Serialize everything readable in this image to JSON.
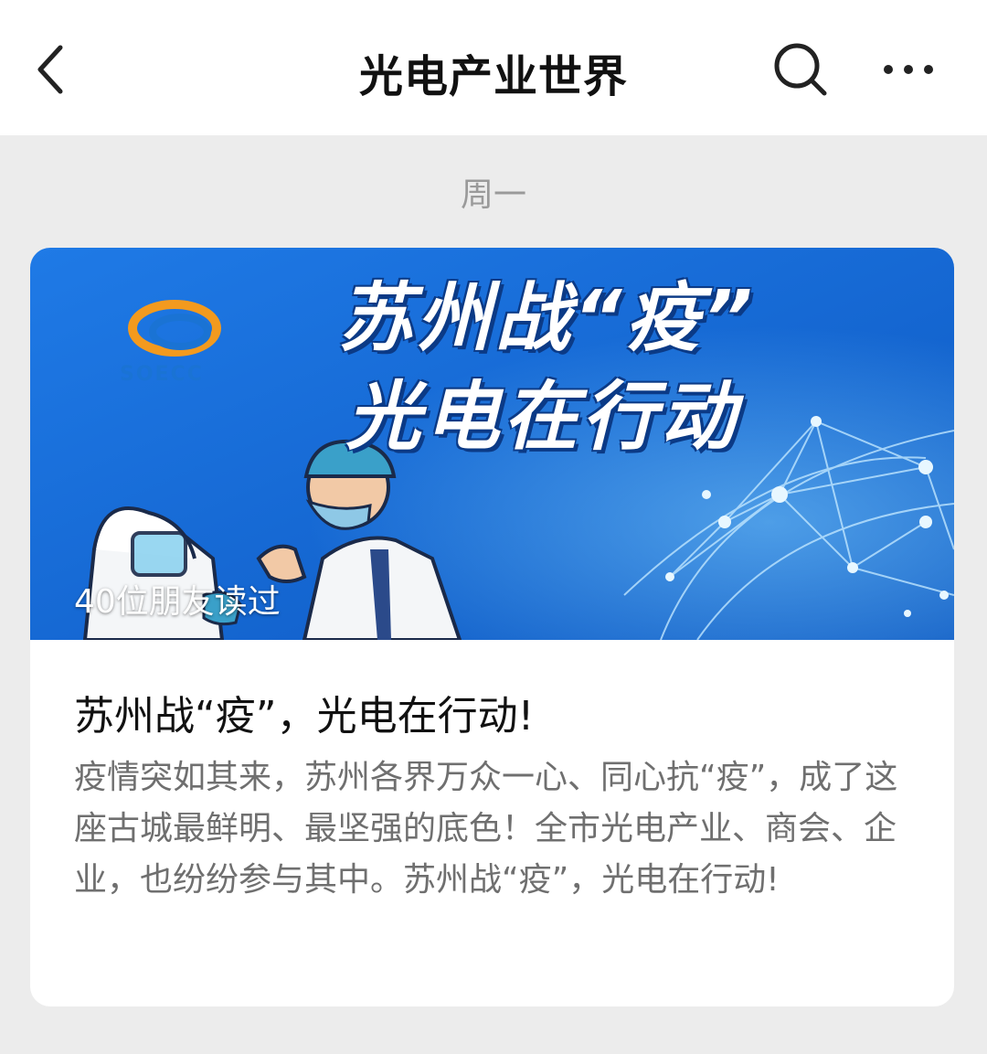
{
  "nav": {
    "title": "光电产业世界",
    "back_icon": "chevron-left-icon",
    "search_icon": "search-icon",
    "more_icon": "more-horizontal-icon"
  },
  "feed": {
    "day_label": "周一"
  },
  "article": {
    "cover": {
      "headline_line1": "苏州战“疫”",
      "headline_line2": "光电在行动",
      "brand": "SOECC",
      "readers": "40位朋友读过",
      "background_color": "#1e6fd9"
    },
    "title": "苏州战“疫”，光电在行动!",
    "summary": "疫情突如其来，苏州各界万众一心、同心抗“疫”，成了这座古城最鲜明、最坚强的底色！全市光电产业、商会、企业，也纷纷参与其中。苏州战“疫”，光电在行动!"
  }
}
